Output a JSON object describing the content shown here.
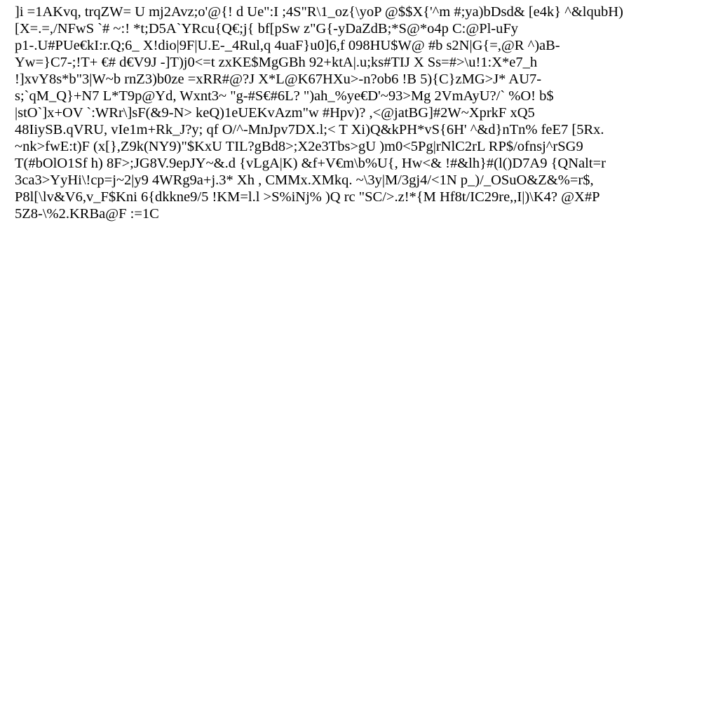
{
  "lines": [
    "]i =1AKvq, trqZW= U mj2Avz;o'@{! d Ue\":I ;4S\"R\\1_oz{\\yoP @$$X{'^m #;ya)bDsd& [e4k} ^&lqubH)",
    "[X=.=,/NFwS `# ~:! *t;D5A`YRcu{Q€;j{ bf[pSw z\"G{-yDaZdB;*S@*o4p C:@Pl-uFy",
    "p1-.U#PUe€kI:r.Q;6_ X!dio|9F|U.E-_4Rul,q 4uaF}u0]6,f 098HU$W@ #b s2N|G{=,@R ^)aB-",
    "Yw=}C7-;!T+ €# d€V9J -]T)j0<=t zxKE$MgGBh 92+ktA|.u;ks#TIJ X Ss=#>\\u!1:X*e7_h",
    "!]xvY8s*b\"3|W~b rnZ3)b0ze =xRR#@?J X*L@K67HXu>-n?ob6 !B 5){C}zMG>J* AU7-",
    "s;`qM_Q}+N7 L*T9p@Yd, Wxnt3~ \"g-#S€#6L? \")ah_%ye€D'~93>Mg 2VmAyU?/` %O! b$",
    "|stO`]x+OV `:WRr\\]sF(&9-N> keQ)1eUEKvAzm\"w #Hpv)? ,<@jatBG]#2W~XprkF xQ5",
    "48IiySB.qVRU, vIe1m+Rk_J?y; qf O/^-MnJpv7DX.l;< T Xi)Q&kPH*vS{6H' ^&d}nTn% feE7 [5Rx.",
    "~nk>fwE:t)F (x[},Z9k(NY9)\"$KxU TIL?gBd8>;X2e3Tbs>gU )m0<5Pg|rNlC2rL RP$/ofnsj^rSG9",
    "T(#bOlO1Sf h) 8F>;JG8V.9epJY~&.d {vLgA|K) &f+V€m\\b%U{, Hw<& !#&lh}#(l()D7A9 {QNalt=r",
    "3ca3>YyHi\\!cp=j~2|y9 4WRg9a+j.3* Xh , CMMx.XMkq. ~\\3y|M/3gj4/<1N p_)/_OSuO&Z&%=r$,",
    "P8l[\\lv&V6,v_F$Kni 6{dkkne9/5 !KM=l.l >S%iNj% )Q rc \"SC/>.z!*{M Hf8t/IC29re,,I|)\\K4? @X#P",
    "5Z8-\\%2.KRBa@F :=1C"
  ]
}
